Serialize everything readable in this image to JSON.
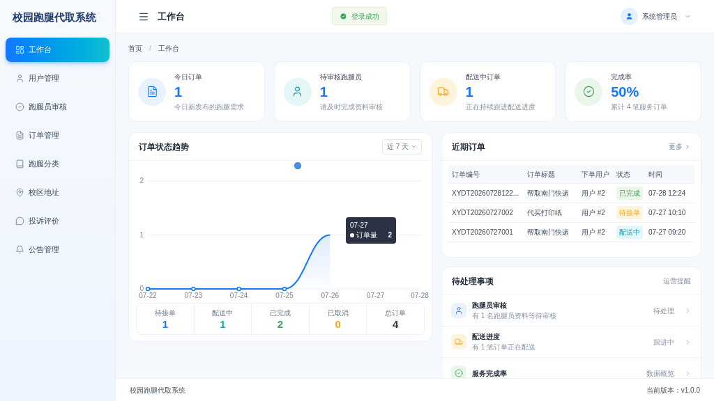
{
  "sidebar": {
    "title": "校园跑腿代取系统",
    "items": [
      {
        "label": "工作台",
        "kind": "dashboard",
        "selected": true
      },
      {
        "label": "用户管理",
        "kind": "user",
        "selected": false
      },
      {
        "label": "跑腿员审核",
        "kind": "check",
        "selected": false
      },
      {
        "label": "订单管理",
        "kind": "doc",
        "selected": false
      },
      {
        "label": "跑腿分类",
        "kind": "book",
        "selected": false
      },
      {
        "label": "校区地址",
        "kind": "pin",
        "selected": false
      },
      {
        "label": "投诉评价",
        "kind": "chat",
        "selected": false
      },
      {
        "label": "公告管理",
        "kind": "bell",
        "selected": false
      }
    ]
  },
  "header": {
    "title": "工作台",
    "toast": "登录成功",
    "user": "系统管理员"
  },
  "breadcrumb": [
    "首页",
    "/",
    "工作台"
  ],
  "stats": [
    {
      "kind": "doc",
      "label": "今日订单",
      "value": "1",
      "note": "今日新发布的跑腿需求"
    },
    {
      "kind": "user",
      "label": "待审核跑腿员",
      "value": "1",
      "note": "请及时完成资料审核"
    },
    {
      "kind": "truck",
      "label": "配送中订单",
      "value": "1",
      "note": "正在持续跟进配送进度"
    },
    {
      "kind": "check",
      "label": "完成率",
      "value": "50%",
      "note": "累计 4 笔服务订单"
    }
  ],
  "trend": {
    "title": "订单状态趋势",
    "range": "近 7 天",
    "tooltip": {
      "date": "07-27",
      "value": "2"
    },
    "chart_data": {
      "type": "line",
      "categories": [
        "07-22",
        "07-23",
        "07-24",
        "07-25",
        "07-26",
        "07-27",
        "07-28"
      ],
      "yticks": [
        0,
        1,
        2
      ],
      "ylim": [
        0,
        2
      ],
      "series": [
        {
          "name": "订单量",
          "color": "#1677ff",
          "marker": true,
          "values": [
            0,
            0,
            0,
            0,
            1,
            null,
            null
          ]
        }
      ]
    },
    "summary": [
      {
        "label": "待接单",
        "value": "1",
        "color": "#1677ff"
      },
      {
        "label": "配送中",
        "value": "1",
        "color": "#13a8b8"
      },
      {
        "label": "已完成",
        "value": "2",
        "color": "#3ba55c"
      },
      {
        "label": "已取消",
        "value": "0",
        "color": "#f5a623"
      },
      {
        "label": "总订单",
        "value": "4",
        "color": "#303640"
      }
    ]
  },
  "recent": {
    "title": "近期订单",
    "more": "更多",
    "columns": [
      "订单编号",
      "订单标题",
      "下单用户",
      "状态",
      "时间"
    ],
    "rows": [
      {
        "id": "XYDT20260728122...",
        "title": "帮取南门快递",
        "user": "用户 #2",
        "status": "已完成",
        "kind": "done",
        "time": "07-28 12:24"
      },
      {
        "id": "XYDT20260727002",
        "title": "代买打印纸",
        "user": "用户 #2",
        "status": "待接单",
        "kind": "pending",
        "time": "07-27 10:10"
      },
      {
        "id": "XYDT20260727001",
        "title": "帮取南门快递",
        "user": "用户 #2",
        "status": "配送中",
        "kind": "delivering",
        "time": "07-27 09:20"
      }
    ]
  },
  "todo": {
    "title": "待处理事项",
    "tag": "运营提醒",
    "items": [
      {
        "kind": "user",
        "title": "跑腿员审核",
        "desc": "有 1 名跑腿员资料等待审核",
        "action": "待处理"
      },
      {
        "kind": "truck",
        "title": "配送进度",
        "desc": "有 1 笔订单正在配送",
        "action": "跟进中"
      },
      {
        "kind": "check",
        "title": "服务完成率",
        "action": "数据概览"
      }
    ]
  },
  "footer": {
    "left": "校园跑腿代取系统",
    "right": "当前版本：v1.0.0"
  }
}
